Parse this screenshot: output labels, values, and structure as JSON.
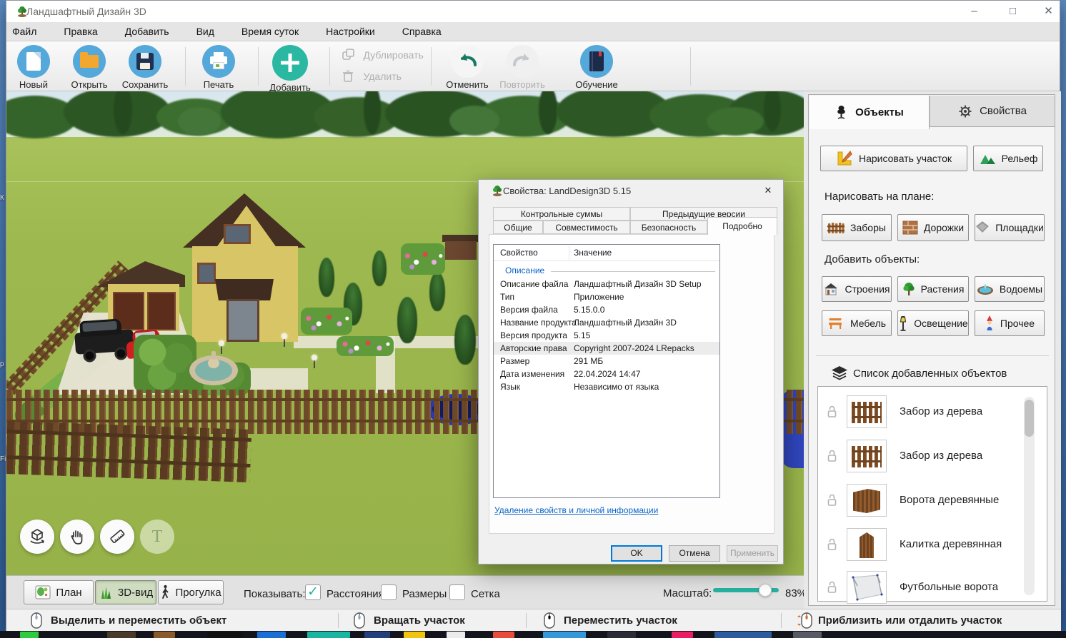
{
  "desktop": {
    "fragments": [
      "К",
      "р",
      "Fi"
    ]
  },
  "window": {
    "title": "Ландшафтный Дизайн 3D"
  },
  "menubar": {
    "items": [
      "Файл",
      "Правка",
      "Добавить",
      "Вид",
      "Время суток",
      "Настройки",
      "Справка"
    ]
  },
  "toolbar": {
    "new": "Новый",
    "open": "Открыть",
    "save": "Сохранить",
    "print": "Печать",
    "add": "Добавить",
    "duplicate": "Дублировать",
    "remove": "Удалить",
    "undo": "Отменить",
    "redo": "Повторить",
    "training": "Обучение"
  },
  "viewport": {
    "text_tool": "T"
  },
  "dialog": {
    "title": "Свойства: LandDesign3D 5.15",
    "tabs_back": [
      "Контрольные суммы",
      "Предыдущие версии"
    ],
    "tabs_front": [
      "Общие",
      "Совместимость",
      "Безопасность",
      "Подробно"
    ],
    "columns": {
      "property": "Свойство",
      "value": "Значение"
    },
    "section": "Описание",
    "rows": [
      {
        "label": "Описание файла",
        "value": "Ландшафтный Дизайн 3D Setup"
      },
      {
        "label": "Тип",
        "value": "Приложение"
      },
      {
        "label": "Версия файла",
        "value": "5.15.0.0"
      },
      {
        "label": "Название продукта",
        "value": "Ландшафтный Дизайн 3D"
      },
      {
        "label": "Версия продукта",
        "value": "5.15"
      },
      {
        "label": "Авторские права",
        "value": "Copyright 2007-2024 LRepacks"
      },
      {
        "label": "Размер",
        "value": "291 МБ"
      },
      {
        "label": "Дата изменения",
        "value": "22.04.2024 14:47"
      },
      {
        "label": "Язык",
        "value": "Независимо от языка"
      }
    ],
    "link": "Удаление свойств и личной информации",
    "ok": "OK",
    "cancel": "Отмена",
    "apply": "Применить"
  },
  "right_panel": {
    "tab_objects": "Объекты",
    "tab_properties": "Свойства",
    "draw_plot": "Нарисовать участок",
    "relief": "Рельеф",
    "draw_on_plan": "Нарисовать на плане:",
    "fences": "Заборы",
    "paths": "Дорожки",
    "grounds": "Площадки",
    "add_objects": "Добавить объекты:",
    "buildings": "Строения",
    "plants": "Растения",
    "ponds": "Водоемы",
    "furniture": "Мебель",
    "lighting": "Освещение",
    "other": "Прочее",
    "list_header": "Список добавленных объектов",
    "items": [
      "Забор из дерева",
      "Забор из дерева",
      "Ворота деревянные",
      "Калитка деревянная",
      "Футбольные ворота"
    ]
  },
  "bottom_bar": {
    "plan": "План",
    "view3d": "3D-вид",
    "walk": "Прогулка",
    "show": "Показывать:",
    "checkboxes": [
      {
        "label": "Расстояния",
        "checked": true
      },
      {
        "label": "Размеры",
        "checked": false
      },
      {
        "label": "Сетка",
        "checked": false
      }
    ],
    "scale_label": "Масштаб:",
    "scale_value": "83%"
  },
  "status_bar": {
    "items": [
      "Выделить и переместить объект",
      "Вращать участок",
      "Переместить участок",
      "Приблизить или отдалить участок"
    ]
  }
}
